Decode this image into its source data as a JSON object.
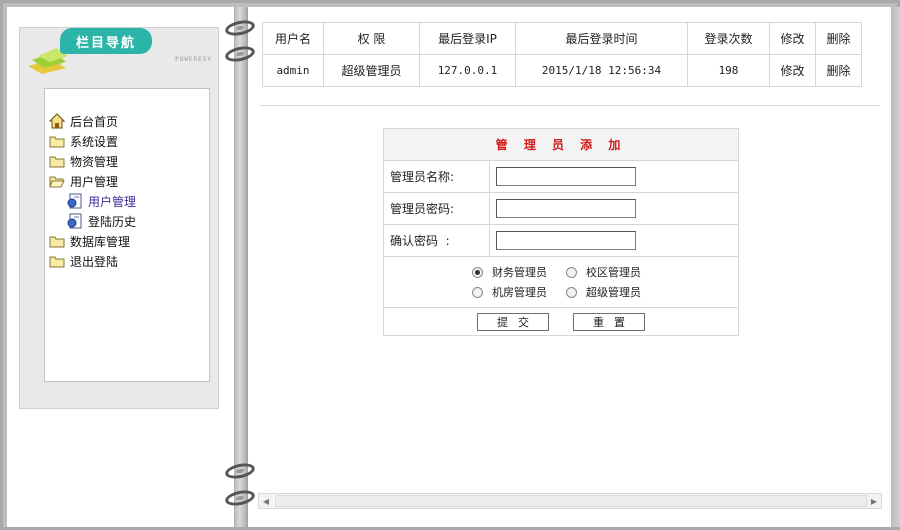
{
  "sidebar": {
    "title": "栏目导航",
    "powered": "POWERESY",
    "items": [
      {
        "label": "后台首页",
        "icon": "home-icon"
      },
      {
        "label": "系统设置",
        "icon": "folder-icon"
      },
      {
        "label": "物资管理",
        "icon": "folder-icon"
      },
      {
        "label": "用户管理",
        "icon": "folder-open-icon"
      },
      {
        "label": "用户管理",
        "icon": "page-icon"
      },
      {
        "label": "登陆历史",
        "icon": "page-icon"
      },
      {
        "label": "数据库管理",
        "icon": "folder-icon"
      },
      {
        "label": "退出登陆",
        "icon": "folder-icon"
      }
    ]
  },
  "users_table": {
    "headers": [
      "用户名",
      "权 限",
      "最后登录IP",
      "最后登录时间",
      "登录次数",
      "修改",
      "删除"
    ],
    "rows": [
      [
        "admin",
        "超级管理员",
        "127.0.0.1",
        "2015/1/18 12:56:34",
        "198",
        "修改",
        "删除"
      ]
    ]
  },
  "admin_form": {
    "title": "管 理 员 添 加",
    "name_label": "管理员名称:",
    "password_label": "管理员密码:",
    "confirm_label": "确认密码  :",
    "roles": [
      "财务管理员",
      "校区管理员",
      "机房管理员",
      "超级管理员"
    ],
    "selected_role": "财务管理员",
    "submit_label": "提交",
    "reset_label": "重置"
  },
  "colors": {
    "nav_title_bg": "#2ab5a8",
    "form_title": "#d11a1a",
    "active_nav": "#3a2a9a"
  }
}
